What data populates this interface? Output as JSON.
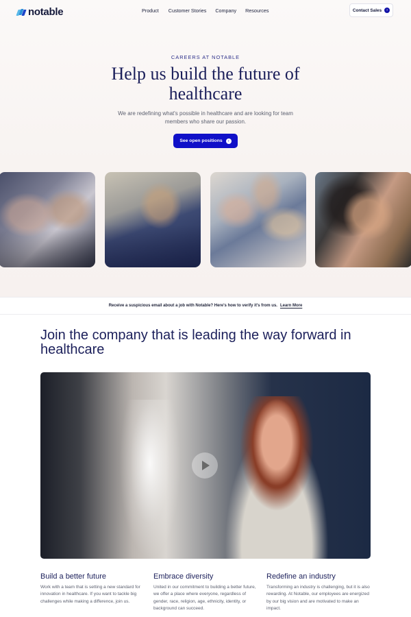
{
  "nav": {
    "logo_text": "notable",
    "links": [
      "Product",
      "Customer Stories",
      "Company",
      "Resources"
    ],
    "contact_label": "Contact Sales"
  },
  "hero": {
    "eyebrow": "CAREERS AT NOTABLE",
    "title": "Help us build the future of healthcare",
    "subtitle": "We are redefining what's possible in healthcare and are looking for team members who share our passion.",
    "cta_label": "See open positions"
  },
  "banner": {
    "text": "Receive a suspicious email about a job with Notable? Here's how to verify it's from us.",
    "link": "Learn More"
  },
  "section": {
    "title": "Join the company that is leading the way forward in healthcare"
  },
  "features": [
    {
      "title": "Build a better future",
      "body": "Work with a team that is setting a new standard for innovation in healthcare. If you want to tackle big challenges while making a difference, join us."
    },
    {
      "title": "Embrace diversity",
      "body": "United in our commitment to building a better future, we offer a place where everyone, regardless of gender, race, religion, age, ethnicity, identity, or background can succeed."
    },
    {
      "title": "Redefine an industry",
      "body": "Transforming an industry is challenging, but it is also rewarding. At Notable, our employees are energized by our big vision and are motivated to make an impact."
    }
  ],
  "colors": {
    "brand": "#1010c8",
    "heading": "#1b1f5a"
  }
}
